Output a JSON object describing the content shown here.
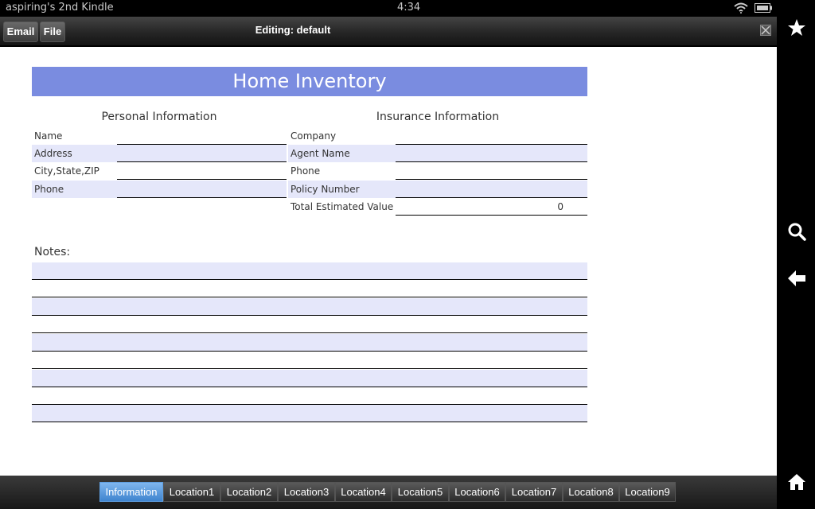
{
  "status": {
    "device_name": "aspiring's 2nd Kindle",
    "time": "4:34"
  },
  "toolbar": {
    "email_label": "Email",
    "file_label": "File",
    "title": "Editing: default"
  },
  "sheet": {
    "title": "Home Inventory",
    "personal": {
      "heading": "Personal Information",
      "fields": [
        "Name",
        "Address",
        "City,State,ZIP",
        "Phone"
      ]
    },
    "insurance": {
      "heading": "Insurance Information",
      "fields": [
        "Company",
        "Agent Name",
        "Phone",
        "Policy Number",
        "Total Estimated Value"
      ],
      "total_value": "0"
    },
    "notes_label": "Notes:"
  },
  "tabs": [
    "Information",
    "Location1",
    "Location2",
    "Location3",
    "Location4",
    "Location5",
    "Location6",
    "Location7",
    "Location8",
    "Location9"
  ],
  "active_tab": "Information",
  "colors": {
    "title_bar": "#7a8ce0",
    "row_shade": "#e5e7fa",
    "active_tab": "#4a8fd8"
  }
}
